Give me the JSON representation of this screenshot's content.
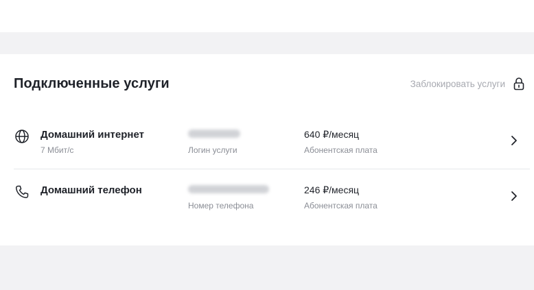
{
  "section": {
    "title": "Подключенные услуги",
    "block_link_label": "Заблокировать услуги",
    "block_icon": "lock-icon"
  },
  "services": [
    {
      "icon": "globe-icon",
      "name": "Домашний интернет",
      "sub": "7 Мбит/с",
      "field_label": "Логин услуги",
      "price": "640 ₽/месяц",
      "price_label": "Абонентская плата"
    },
    {
      "icon": "phone-icon",
      "name": "Домашний телефон",
      "sub": "",
      "field_label": "Номер телефона",
      "price": "246 ₽/месяц",
      "price_label": "Абонентская плата"
    }
  ]
}
